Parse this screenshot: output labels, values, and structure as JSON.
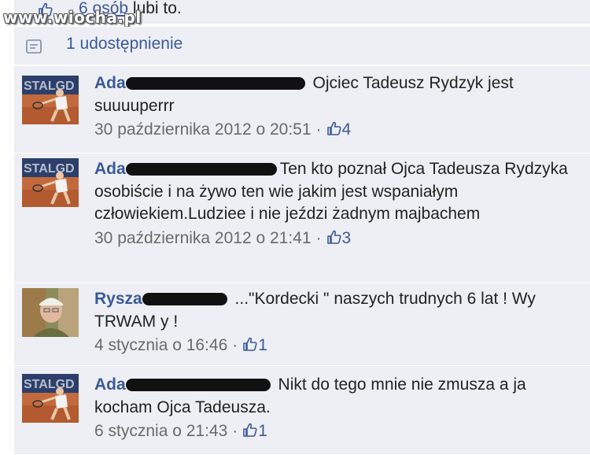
{
  "watermark": "www.wiocha.pl",
  "likes": {
    "count_text": "6 osób",
    "suffix_text": " lubi to."
  },
  "shares": {
    "text": "1 udostępnienie"
  },
  "comments": [
    {
      "author": "Ada",
      "text": "Ojciec Tadeusz Rydzyk jest suuuuperrr",
      "timestamp": "30 października 2012 o 20:51",
      "like_count": "4"
    },
    {
      "author": "Ada",
      "text": "Ten kto poznał Ojca Tadeusza Rydzyka osobiście i na żywo ten wie jakim jest wspaniałym człowiekiem.Ludziee i nie jeździ żadnym majbachem",
      "timestamp": "30 października 2012 o 21:41",
      "like_count": "3"
    },
    {
      "author": "Rysza",
      "text": "...\"Kordecki \" naszych trudnych 6 lat ! Wy TRWAM y !",
      "timestamp": "4 stycznia o 16:46",
      "like_count": "1"
    },
    {
      "author": "Ada",
      "text": "Nikt do tego mnie nie zmusza a ja kocham Ojca Tadeusza.",
      "timestamp": "6 stycznia o 21:43",
      "like_count": "1"
    }
  ],
  "colors": {
    "link": "#3b5998",
    "row_background": "#edeff4",
    "meta": "#6a6a6a",
    "redaction": "#111111"
  }
}
